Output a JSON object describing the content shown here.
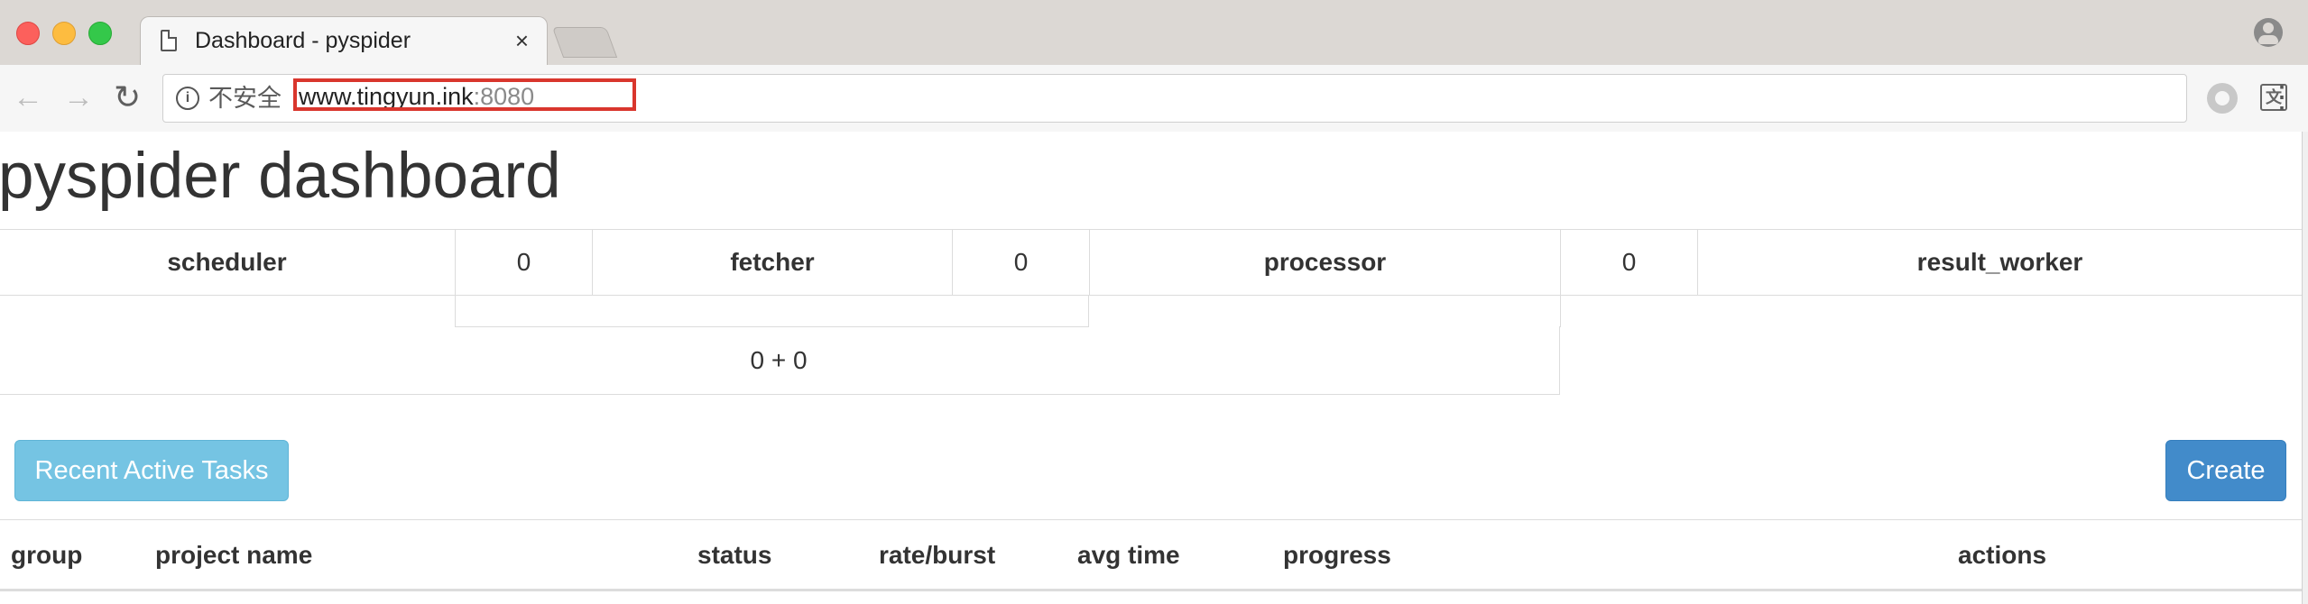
{
  "browser": {
    "tab_title": "Dashboard - pyspider",
    "tab_close": "×",
    "security_text": "不安全",
    "url_host": "www.tingyun.ink",
    "url_port": ":8080",
    "icons": {
      "back": "arrow-left-icon",
      "forward": "arrow-right-icon",
      "reload": "reload-icon",
      "info": "info-icon",
      "translate": "translate-icon",
      "bookmark": "star-icon",
      "extension": "extension-icon",
      "menu": "kebab-menu-icon",
      "profile": "profile-icon"
    },
    "highlight_color": "#d9362d"
  },
  "page": {
    "title": "pyspider dashboard",
    "queues": {
      "scheduler_label": "scheduler",
      "scheduler_to_fetcher": "0",
      "fetcher_label": "fetcher",
      "fetcher_to_processor": "0",
      "processor_label": "processor",
      "processor_to_result": "0",
      "result_worker_label": "result_worker",
      "sum": "0 + 0"
    },
    "buttons": {
      "recent_active": "Recent Active Tasks",
      "create": "Create"
    },
    "table": {
      "headers": [
        "group",
        "project name",
        "status",
        "rate/burst",
        "avg time",
        "progress",
        "actions"
      ]
    },
    "colors": {
      "info_button": "#75c4e3",
      "primary_button": "#428bca"
    }
  }
}
